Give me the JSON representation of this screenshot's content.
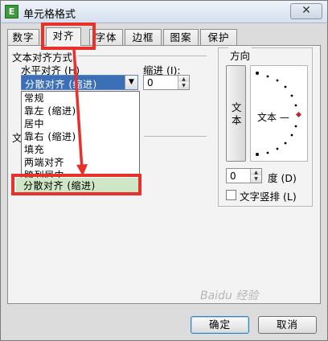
{
  "window": {
    "title": "单元格格式",
    "app_icon_glyph": "E",
    "close_glyph": "✕"
  },
  "tabs": [
    {
      "label": "数字",
      "active": false
    },
    {
      "label": "对齐",
      "active": true
    },
    {
      "label": "字体",
      "active": false
    },
    {
      "label": "边框",
      "active": false
    },
    {
      "label": "图案",
      "active": false
    },
    {
      "label": "保护",
      "active": false
    }
  ],
  "alignment": {
    "section_title": "文本对齐方式",
    "horizontal_label": "水平对齐 (H)",
    "horizontal_value": "分散对齐 (缩进)",
    "indent_label": "缩进 (I):",
    "indent_value": "0",
    "vertical_label_partial": "文"
  },
  "dropdown": {
    "items": [
      "常规",
      "靠左 (缩进)",
      "居中",
      "靠右 (缩进)",
      "填充",
      "两端对齐",
      "跨列居中",
      "分散对齐 (缩进)"
    ],
    "selected_index": 7
  },
  "orientation": {
    "title": "方向",
    "vertical_text": "文本",
    "dial_label": "文本 —",
    "degree_value": "0",
    "degree_label": "度 (D)",
    "vertical_checkbox_label": "文字竖排 (L)"
  },
  "buttons": {
    "ok": "确定",
    "cancel": "取消"
  },
  "watermark": "Baidu 经验",
  "colors": {
    "highlight_red": "#e8312b",
    "selection_blue": "#3b6fb6",
    "selected_item_green": "#cfe7c6"
  }
}
